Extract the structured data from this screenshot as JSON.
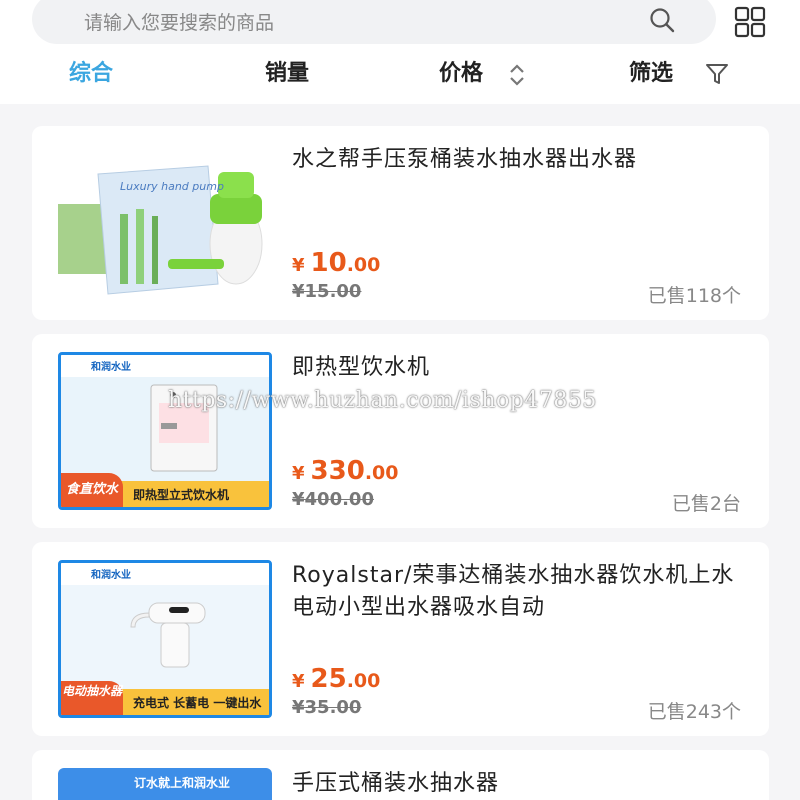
{
  "search": {
    "placeholder": "请输入您要搜索的商品"
  },
  "sort": {
    "items": [
      "综合",
      "销量",
      "价格",
      "筛选"
    ],
    "active": "综合"
  },
  "products": [
    {
      "title": "水之帮手压泵桶装水抽水器出水器",
      "price_int": "10",
      "price_dec": ".00",
      "currency": "¥",
      "original": "¥15.00",
      "sold": "已售118个",
      "thumb_text": "Luxury hand pump"
    },
    {
      "title": "即热型饮水机",
      "price_int": "330",
      "price_dec": ".00",
      "currency": "¥",
      "original": "¥400.00",
      "sold": "已售2台",
      "brand": "和润水业",
      "tag": "食直饮水机",
      "bar_text": "即热型立式饮水机"
    },
    {
      "title": "Royalstar/荣事达桶装水抽水器饮水机上水电动小型出水器吸水自动",
      "price_int": "25",
      "price_dec": ".00",
      "currency": "¥",
      "original": "¥35.00",
      "sold": "已售243个",
      "brand": "和润水业",
      "tag": "电动抽水器",
      "bar_text": "充电式 长蓄电 一键出水"
    },
    {
      "title": "手压式桶装水抽水器",
      "thumb_text": "订水就上和润水业"
    }
  ],
  "watermark": "https://www.huzhan.com/ishop47855",
  "colors": {
    "accent": "#3ba6e0",
    "price": "#e8591a",
    "background": "#f5f5f7"
  }
}
